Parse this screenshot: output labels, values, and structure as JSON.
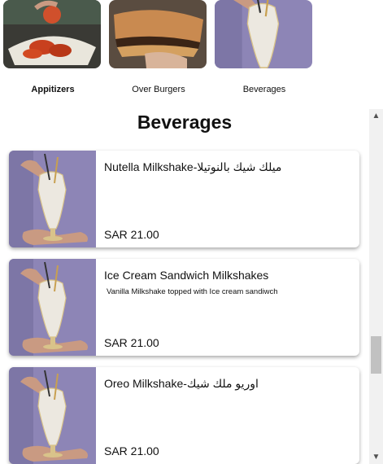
{
  "categories": [
    {
      "label": "Appitizers",
      "active": true
    },
    {
      "label": "Over Burgers",
      "active": false
    },
    {
      "label": "Beverages",
      "active": false
    }
  ],
  "section_title": "Beverages",
  "items": [
    {
      "name": "Nutella Milkshake-ميلك شيك بالنوتيلا",
      "description": "",
      "price": "SAR 21.00"
    },
    {
      "name": "Ice Cream Sandwich Milkshakes",
      "description": "Vanilla Milkshake topped with Ice cream sandiwch",
      "price": "SAR 21.00"
    },
    {
      "name": "Oreo Milkshake-اوريو ملك شيك",
      "description": "",
      "price": "SAR 21.00"
    }
  ],
  "colors": {
    "milkshake_bg": "#8f86b8",
    "accent": "#111111"
  }
}
